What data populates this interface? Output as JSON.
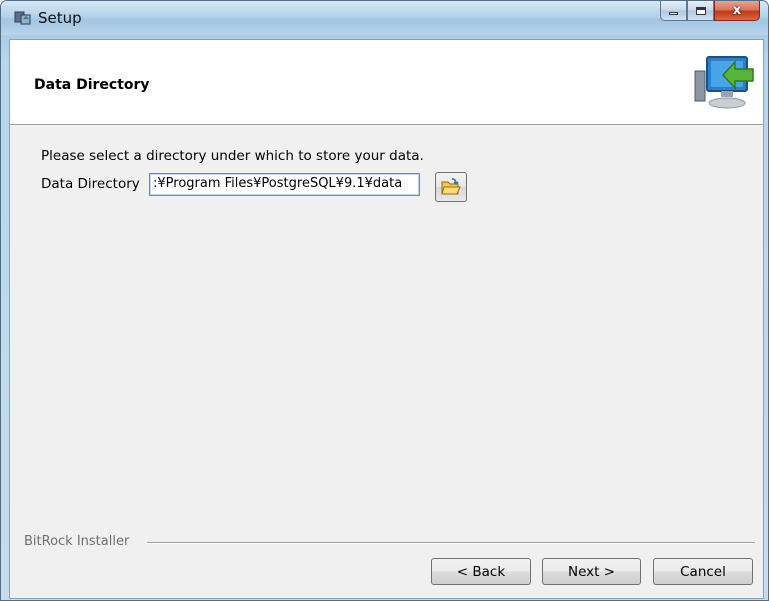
{
  "window": {
    "title": "Setup",
    "icons": {
      "app": "setup-app-icon",
      "minimize": "minimize-icon",
      "maximize": "maximize-icon",
      "close": "close-icon"
    },
    "close_glyph": "x"
  },
  "header": {
    "title": "Data Directory",
    "art_icon": "computer-arrow-icon"
  },
  "body": {
    "prompt": "Please select a directory under which to store your data.",
    "field_label": "Data Directory",
    "field_value": ":¥Program Files¥PostgreSQL¥9.1¥data",
    "browse_icon": "folder-open-icon"
  },
  "footer": {
    "installer_label": "BitRock Installer",
    "back_label": "< Back",
    "next_label": "Next >",
    "cancel_label": "Cancel"
  },
  "colors": {
    "titlebar": "#a7cbe6",
    "close_button": "#c2391b",
    "client_bg": "#f0f0f0"
  }
}
